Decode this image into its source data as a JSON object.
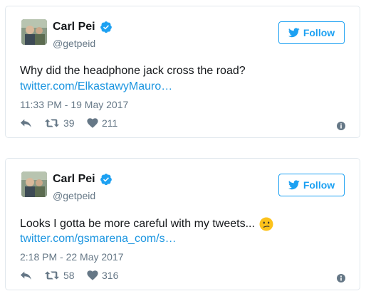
{
  "tweets": [
    {
      "name": "Carl Pei",
      "handle": "@getpeid",
      "follow_label": "Follow",
      "text": "Why did the headphone jack cross the road?",
      "link": "twitter.com/ElkastawyMauro…",
      "timestamp": "11:33 PM - 19 May 2017",
      "retweets": "39",
      "likes": "211"
    },
    {
      "name": "Carl Pei",
      "handle": "@getpeid",
      "follow_label": "Follow",
      "text": "Looks I gotta be more careful with my tweets...",
      "emoji": "confused-face",
      "link": "twitter.com/gsmarena_com/s…",
      "timestamp": "2:18 PM - 22 May 2017",
      "retweets": "58",
      "likes": "316"
    }
  ],
  "colors": {
    "accent": "#1da1f2",
    "link": "#1b95e0",
    "muted": "#657786",
    "border": "#e1e8ed"
  }
}
